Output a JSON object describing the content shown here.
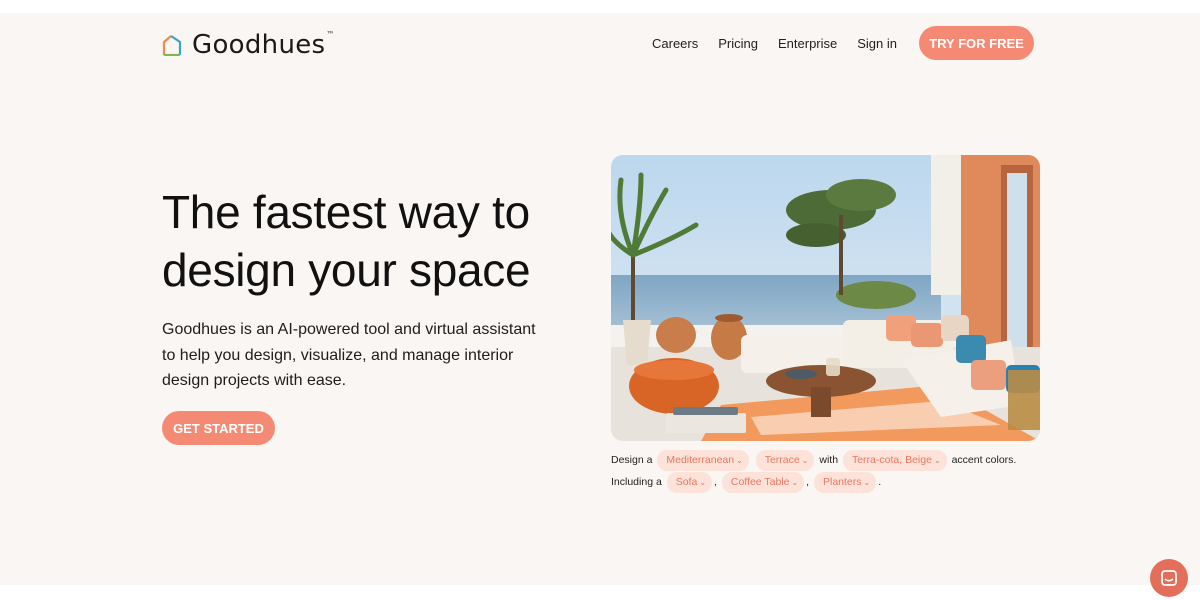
{
  "header": {
    "brand": "Goodhues",
    "brand_mark": "™",
    "logo_icon": "house-outline-icon",
    "nav": [
      "Careers",
      "Pricing",
      "Enterprise",
      "Sign in"
    ],
    "cta": "TRY FOR FREE"
  },
  "hero": {
    "title": "The fastest way to design your space",
    "description": "Goodhues is an AI-powered tool and virtual assistant to help you design, visualize, and manage interior design projects with ease.",
    "cta": "GET STARTED"
  },
  "prompt": {
    "t1": "Design a",
    "style": "Mediterranean",
    "room": "Terrace",
    "t2": "with",
    "colors": "Terra-cota, Beige",
    "t3": "accent colors. Including a",
    "item1": "Sofa",
    "sep1": ",",
    "item2": "Coffee Table",
    "sep2": ",",
    "item3": "Planters",
    "end": "."
  },
  "chat": {
    "icon": "chat-launcher-icon"
  },
  "colors": {
    "accent": "#f58a74",
    "chip_bg": "#fde2da",
    "chip_text": "#e8785f",
    "page_bg": "#faf6f3"
  }
}
